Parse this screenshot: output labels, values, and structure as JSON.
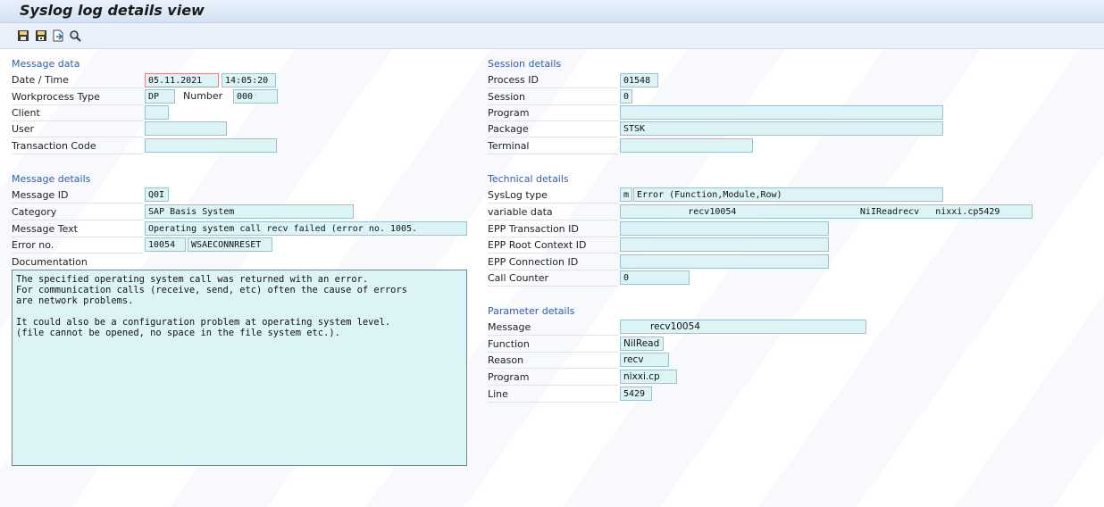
{
  "window": {
    "title": "Syslog log details view"
  },
  "toolbar": {
    "icons": [
      "save-icon",
      "save-as-icon",
      "export-icon",
      "find-icon"
    ]
  },
  "message_data": {
    "header": "Message data",
    "date_time_label": "Date / Time",
    "date": "05.11.2021",
    "time": "14:05:20",
    "wp_type_label": "Workprocess Type",
    "wp_type": "DP",
    "number_label": "Number",
    "number": "000",
    "client_label": "Client",
    "client": "",
    "user_label": "User",
    "user": "",
    "tcode_label": "Transaction Code",
    "tcode": ""
  },
  "message_details": {
    "header": "Message details",
    "id_label": "Message ID",
    "id": "Q0I",
    "category_label": "Category",
    "category": "SAP Basis System",
    "text_label": "Message Text",
    "text": "Operating system call recv failed (error no. 1005.",
    "error_label": "Error no.",
    "error_no": "10054",
    "error_name": "WSAECONNRESET",
    "doc_label": "Documentation",
    "documentation": "The specified operating system call was returned with an error.\nFor communication calls (receive, send, etc) often the cause of errors\nare network problems.\n\nIt could also be a configuration problem at operating system level.\n(file cannot be opened, no space in the file system etc.)."
  },
  "session_details": {
    "header": "Session details",
    "pid_label": "Process ID",
    "pid": "01548",
    "session_label": "Session",
    "session": "0",
    "program_label": "Program",
    "program": "",
    "package_label": "Package",
    "package": "STSK",
    "terminal_label": "Terminal",
    "terminal": ""
  },
  "technical_details": {
    "header": "Technical details",
    "syslog_type_label": "SysLog type",
    "syslog_type_code": "m",
    "syslog_type": "Error (Function,Module,Row)",
    "variable_label": "variable data",
    "variable_data": "            recv10054                       NiIReadrecv   nixxi.cp5429",
    "epp_tid_label": "EPP Transaction ID",
    "epp_tid": "",
    "epp_root_label": "EPP Root Context ID",
    "epp_root": "",
    "epp_conn_label": "EPP Connection ID",
    "epp_conn": "",
    "call_counter_label": "Call Counter",
    "call_counter": "0"
  },
  "parameter_details": {
    "header": "Parameter details",
    "message_label": "Message",
    "message": "         recv10054",
    "function_label": "Function",
    "function": "NiIRead",
    "reason_label": "Reason",
    "reason": "recv",
    "program_label": "Program",
    "program": "nixxi.cp",
    "line_label": "Line",
    "line": "5429"
  }
}
